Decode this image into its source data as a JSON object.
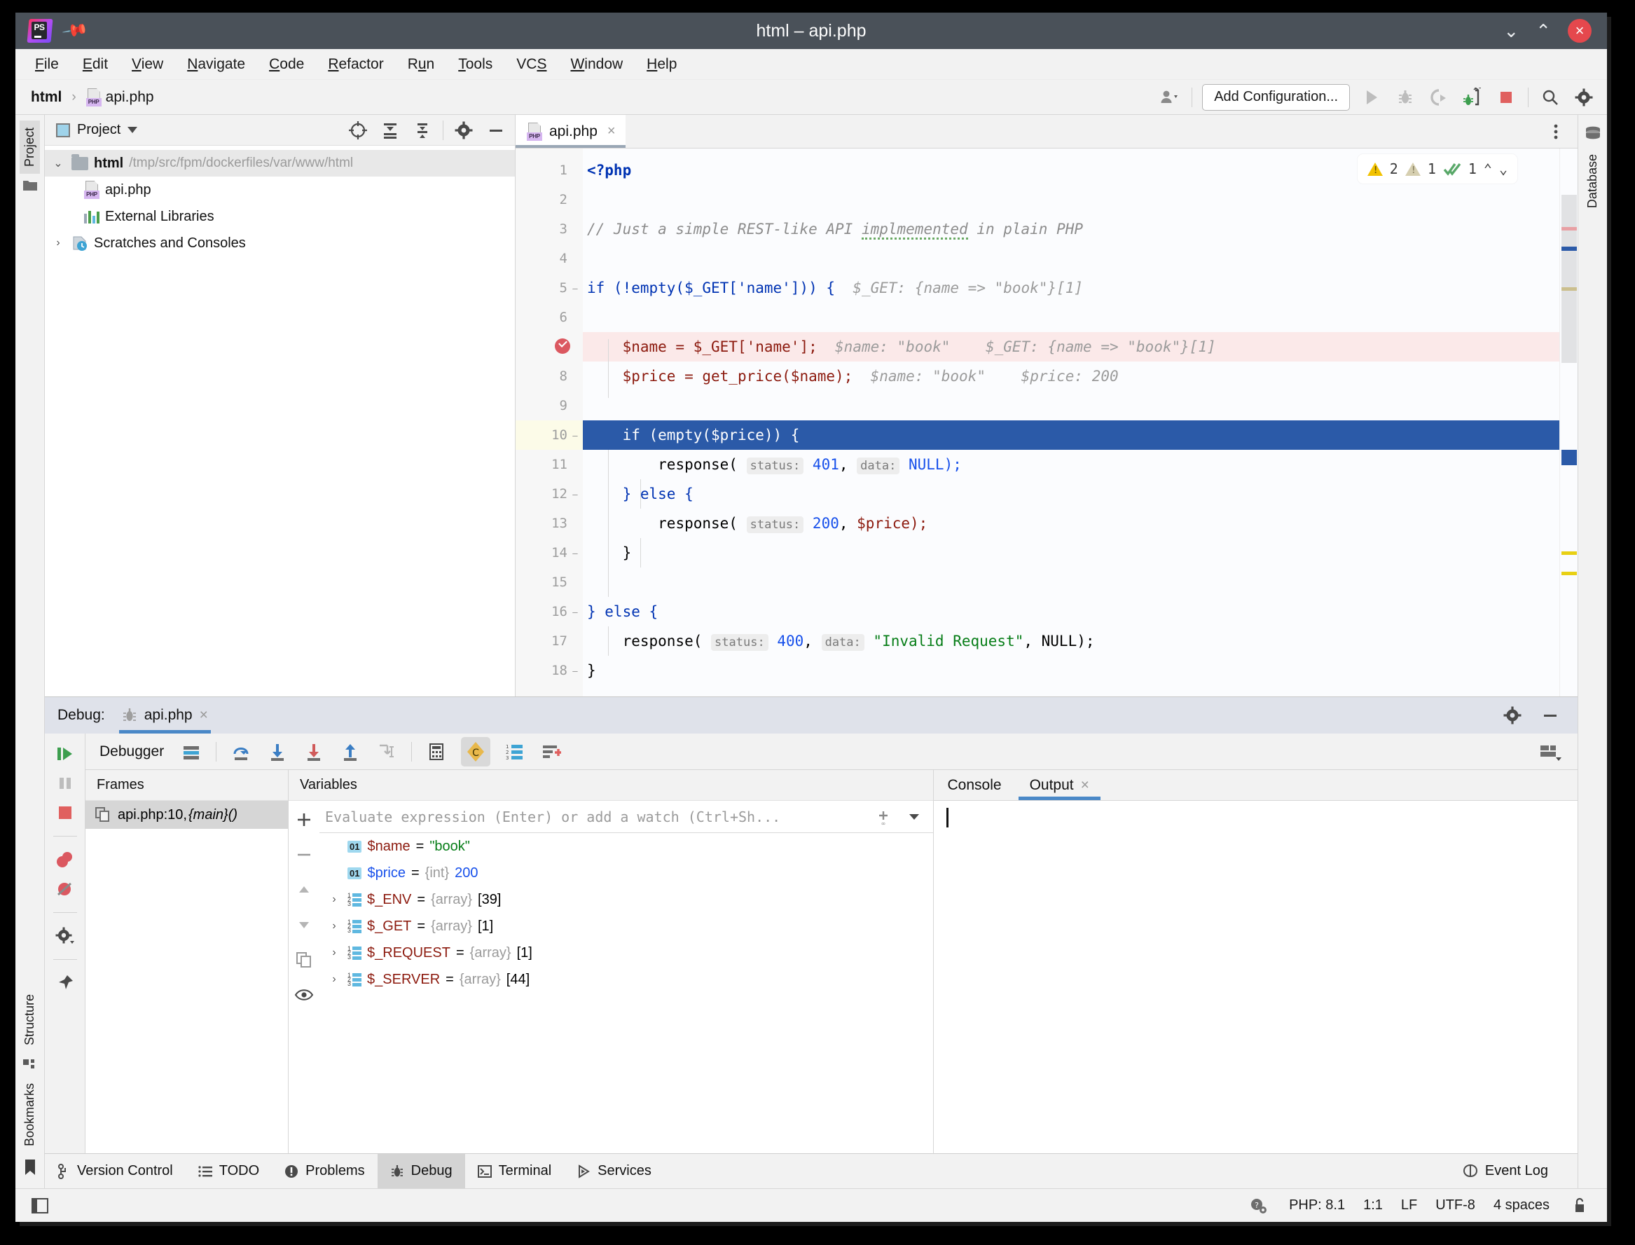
{
  "window": {
    "title": "html – api.php",
    "app_icon": "phpstorm-logo-icon",
    "pin_icon": "pin-icon",
    "minimize_label": "⌄",
    "maximize_label": "⌃",
    "close_label": "×"
  },
  "menubar": [
    {
      "label": "File",
      "mnemonic": "F"
    },
    {
      "label": "Edit",
      "mnemonic": "E"
    },
    {
      "label": "View",
      "mnemonic": "V"
    },
    {
      "label": "Navigate",
      "mnemonic": "N"
    },
    {
      "label": "Code",
      "mnemonic": "C"
    },
    {
      "label": "Refactor",
      "mnemonic": "R"
    },
    {
      "label": "Run",
      "mnemonic": "u"
    },
    {
      "label": "Tools",
      "mnemonic": "T"
    },
    {
      "label": "VCS",
      "mnemonic": "S"
    },
    {
      "label": "Window",
      "mnemonic": "W"
    },
    {
      "label": "Help",
      "mnemonic": "H"
    }
  ],
  "navbar": {
    "project_crumb": "html",
    "separator": "›",
    "file_crumb": "api.php",
    "add_configuration": "Add Configuration...",
    "icons": [
      "user-profile-icon",
      "run-icon",
      "debug-icon",
      "run-coverage-icon",
      "phone-listen-debug-icon",
      "stop-icon",
      "search-icon",
      "settings-gear-icon"
    ]
  },
  "left_rail": {
    "project_tab": "Project",
    "structure_tab": "Structure",
    "bookmarks_tab": "Bookmarks"
  },
  "right_rail": {
    "database_tab": "Database"
  },
  "project_panel": {
    "title": "Project",
    "actions": [
      "locate-target-icon",
      "expand-all-icon",
      "collapse-all-icon",
      "settings-gear-icon",
      "hide-icon"
    ],
    "tree": [
      {
        "label": "html",
        "path": "/tmp/src/fpm/dockerfiles/var/www/html",
        "icon": "folder-icon",
        "arrow": "⌄",
        "selected": true,
        "indent": 0
      },
      {
        "label": "api.php",
        "path": "",
        "icon": "php-file-icon",
        "arrow": "",
        "selected": false,
        "indent": 1
      },
      {
        "label": "External Libraries",
        "path": "",
        "icon": "libraries-icon",
        "arrow": "",
        "selected": false,
        "indent": 1
      },
      {
        "label": "Scratches and Consoles",
        "path": "",
        "icon": "scratches-icon",
        "arrow": "›",
        "selected": false,
        "indent": 0
      }
    ]
  },
  "editor": {
    "tab_label": "api.php",
    "tab_icon": "php-file-icon",
    "tab_close": "×",
    "more_icon": "more-vertical-icon",
    "inspections": {
      "warning_count": "2",
      "weak_warning_count": "1",
      "ok_count": "1",
      "prev_label": "⌃",
      "next_label": "⌄"
    },
    "lines": [
      {
        "n": "1"
      },
      {
        "n": "2"
      },
      {
        "n": "3"
      },
      {
        "n": "4"
      },
      {
        "n": "5",
        "fold": "⊖"
      },
      {
        "n": "6"
      },
      {
        "n": "7",
        "breakpoint": true
      },
      {
        "n": "8"
      },
      {
        "n": "9"
      },
      {
        "n": "10",
        "fold": "⊖",
        "current": true
      },
      {
        "n": "11"
      },
      {
        "n": "12",
        "fold": "⊖"
      },
      {
        "n": "13"
      },
      {
        "n": "14",
        "fold": "⊖"
      },
      {
        "n": "15"
      },
      {
        "n": "16",
        "fold": "⊖"
      },
      {
        "n": "17"
      },
      {
        "n": "18",
        "fold": "⊖"
      }
    ],
    "code": {
      "l1": "<?php",
      "l3_comment": "// Just a simple REST-like API ",
      "l3_typo": "implmemented",
      "l3_tail": " in plain PHP",
      "l5": "if (!empty($_GET['name'])) {",
      "l5_hint": "$_GET: {name => \"book\"}[1]",
      "l7": "$name = $_GET['name'];",
      "l7_hint1": "$name: \"book\"",
      "l7_hint2": "$_GET: {name => \"book\"}[1]",
      "l8": "$price = get_price($name);",
      "l8_hint1": "$name: \"book\"",
      "l8_hint2": "$price: 200",
      "l10": "if (empty($price)) {",
      "l11_fn": "response(",
      "l11_p1": "status:",
      "l11_v1": "401",
      "l11_p2": "data:",
      "l11_v2": "NULL);",
      "l12": "} else {",
      "l13_fn": "response(",
      "l13_p1": "status:",
      "l13_v1": "200",
      "l13_v2": "$price);",
      "l14": "}",
      "l16": "} else {",
      "l17_fn": "response(",
      "l17_p1": "status:",
      "l17_v1": "400",
      "l17_p2": "data:",
      "l17_v2": "\"Invalid Request\"",
      "l17_v3": ", NULL);",
      "l18": "}"
    }
  },
  "debug": {
    "header_label": "Debug:",
    "session_tab": "api.php",
    "session_tab_icon": "bug-icon",
    "session_close": "×",
    "settings_icon": "settings-gear-icon",
    "hide_icon": "hide-icon",
    "layout_icon": "layout-settings-icon",
    "rail_icons": [
      "resume-program-icon",
      "pause-program-icon",
      "stop-icon",
      "view-breakpoints-icon",
      "mute-breakpoints-icon",
      "settings-gear-icon",
      "pin-tab-icon"
    ],
    "toolbar": {
      "tab_name": "Debugger",
      "icons": [
        "show-execution-point-icon",
        "step-over-icon",
        "step-into-icon",
        "force-step-into-icon",
        "step-out-icon",
        "run-to-cursor-icon",
        "evaluate-expression-icon",
        "c-mark-icon",
        "variables-order-icon",
        "add-watch-icon"
      ]
    },
    "frames": {
      "header": "Frames",
      "rows": [
        {
          "label": "api.php:10, ",
          "italic": "{main}()",
          "icon": "frame-icon",
          "selected": true
        }
      ]
    },
    "variables": {
      "header": "Variables",
      "rail_icons": [
        "add-icon",
        "remove-icon",
        "up-icon",
        "down-icon",
        "copy-icon",
        "watch-eye-icon"
      ],
      "watch_placeholder": "Evaluate expression (Enter) or add a watch (Ctrl+Sh...",
      "watch_value": "",
      "watch_add_icon": "add-watch-icon",
      "watch_dropdown_icon": "chevron-down-icon",
      "rows": [
        {
          "expand": "",
          "icon": "primitive-icon",
          "name": "$name",
          "eq": " = ",
          "type": "",
          "value": "\"book\"",
          "vclass": "vstr"
        },
        {
          "expand": "",
          "icon": "primitive-icon",
          "name": "$price",
          "eq": " = ",
          "type": "{int} ",
          "value": "200",
          "vclass": "vnum",
          "nameclass": "blue"
        },
        {
          "expand": "›",
          "icon": "array-icon",
          "name": "$_ENV",
          "eq": " = ",
          "type": "{array} ",
          "value": "[39]",
          "vclass": ""
        },
        {
          "expand": "›",
          "icon": "array-icon",
          "name": "$_GET",
          "eq": " = ",
          "type": "{array} ",
          "value": "[1]",
          "vclass": ""
        },
        {
          "expand": "›",
          "icon": "array-icon",
          "name": "$_REQUEST",
          "eq": " = ",
          "type": "{array} ",
          "value": "[1]",
          "vclass": ""
        },
        {
          "expand": "›",
          "icon": "array-icon",
          "name": "$_SERVER",
          "eq": " = ",
          "type": "{array} ",
          "value": "[44]",
          "vclass": ""
        }
      ]
    },
    "console": {
      "tabs": [
        {
          "label": "Console",
          "active": false,
          "closable": false
        },
        {
          "label": "Output",
          "active": true,
          "closable": true,
          "close": "×"
        }
      ],
      "body_text": ""
    }
  },
  "bottom_tabs": [
    {
      "label": "Version Control",
      "icon": "branch-icon",
      "active": false
    },
    {
      "label": "TODO",
      "icon": "todo-list-icon",
      "active": false
    },
    {
      "label": "Problems",
      "icon": "problems-icon",
      "active": false
    },
    {
      "label": "Debug",
      "icon": "bug-icon",
      "active": true
    },
    {
      "label": "Terminal",
      "icon": "terminal-icon",
      "active": false
    },
    {
      "label": "Services",
      "icon": "services-icon",
      "active": false
    }
  ],
  "event_log": {
    "label": "Event Log",
    "icon": "balloon-icon"
  },
  "statusbar": {
    "left_icon": "toggle-toolwindows-icon",
    "interpreter_icon": "php-help-icon",
    "php_version": "PHP: 8.1",
    "caret_position": "1:1",
    "line_separator": "LF",
    "encoding": "UTF-8",
    "indent": "4 spaces",
    "lock_icon": "unlocked-icon"
  },
  "colors": {
    "titlebar": "#4a5159",
    "accent_blue": "#4a88c7",
    "selection_blue": "#2b5aa8",
    "error_red": "#db5860",
    "warning_yellow": "#f2c200",
    "ok_green": "#59a869"
  }
}
